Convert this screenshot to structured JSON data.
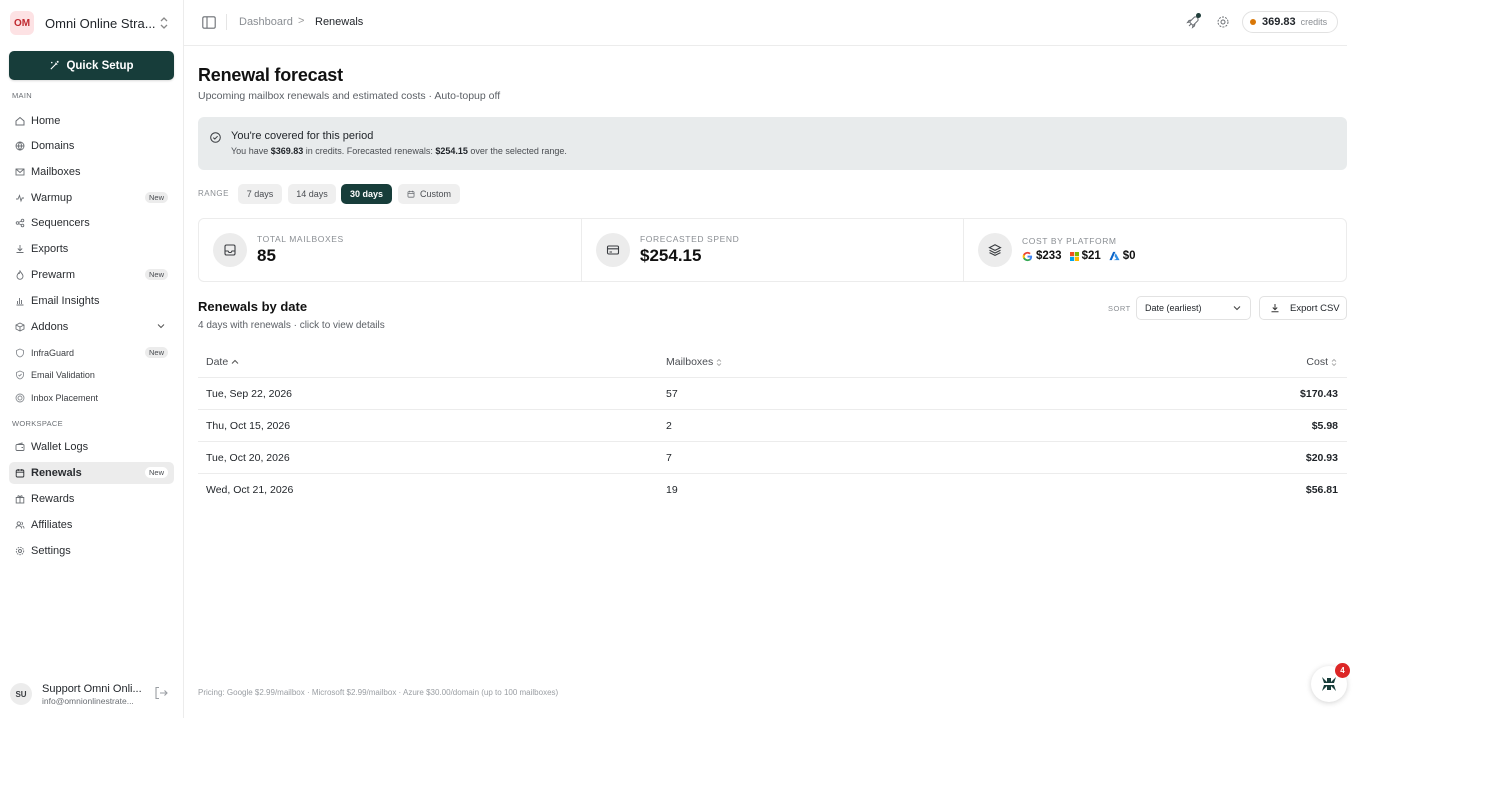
{
  "workspace": {
    "initials": "OM",
    "name": "Omni Online Stra..."
  },
  "quick_setup": {
    "label": "Quick Setup"
  },
  "sidebar": {
    "main_label": "MAIN",
    "workspace_label": "WORKSPACE",
    "badge_new": "New",
    "items": [
      {
        "label": "Home"
      },
      {
        "label": "Domains"
      },
      {
        "label": "Mailboxes"
      },
      {
        "label": "Warmup"
      },
      {
        "label": "Sequencers"
      },
      {
        "label": "Exports"
      },
      {
        "label": "Prewarm"
      },
      {
        "label": "Email Insights"
      },
      {
        "label": "Addons"
      }
    ],
    "addons": [
      {
        "label": "InfraGuard"
      },
      {
        "label": "Email Validation"
      },
      {
        "label": "Inbox Placement"
      }
    ],
    "workspace_items": [
      {
        "label": "Wallet Logs"
      },
      {
        "label": "Renewals"
      },
      {
        "label": "Rewards"
      },
      {
        "label": "Affiliates"
      },
      {
        "label": "Settings"
      }
    ]
  },
  "user": {
    "initials": "SU",
    "name": "Support Omni Onli...",
    "email": "info@omnionlinestrate..."
  },
  "breadcrumb": {
    "parent": "Dashboard",
    "separator": ">",
    "current": "Renewals"
  },
  "credits": {
    "amount": "369.83",
    "label": "credits"
  },
  "page": {
    "title": "Renewal forecast",
    "subtitle": "Upcoming mailbox renewals and estimated costs · Auto-topup off"
  },
  "covered": {
    "title": "You're covered for this period",
    "text_1": "You have ",
    "credits": "$369.83",
    "text_2": " in credits. Forecasted renewals: ",
    "renewals": "$254.15",
    "text_3": " over the selected range."
  },
  "range": {
    "label": "RANGE",
    "options": [
      "7 days",
      "14 days",
      "30 days",
      "Custom"
    ],
    "selected": "30 days"
  },
  "stats": {
    "total_label": "TOTAL MAILBOXES",
    "total_value": "85",
    "spend_label": "FORECASTED SPEND",
    "spend_value": "$254.15",
    "platform_label": "COST BY PLATFORM",
    "google": "$233",
    "microsoft": "$21",
    "azure": "$0"
  },
  "renewals": {
    "title": "Renewals by date",
    "subtitle": "4 days with renewals · click to view details",
    "sort_label": "SORT",
    "sort_value": "Date (earliest)",
    "export_label": "Export CSV",
    "columns": [
      "Date",
      "Mailboxes",
      "Cost"
    ],
    "rows": [
      {
        "date": "Tue, Sep 22, 2026",
        "mailboxes": "57",
        "cost": "$170.43"
      },
      {
        "date": "Thu, Oct 15, 2026",
        "mailboxes": "2",
        "cost": "$5.98"
      },
      {
        "date": "Tue, Oct 20, 2026",
        "mailboxes": "7",
        "cost": "$20.93"
      },
      {
        "date": "Wed, Oct 21, 2026",
        "mailboxes": "19",
        "cost": "$56.81"
      }
    ]
  },
  "pricing": "Pricing: Google $2.99/mailbox · Microsoft $2.99/mailbox · Azure $30.00/domain (up to 100 mailboxes)",
  "chat": {
    "badge": "4"
  },
  "colors": {
    "accent": "#173d3a",
    "credit_dot": "#d97706",
    "badge_red": "#dc2626"
  }
}
